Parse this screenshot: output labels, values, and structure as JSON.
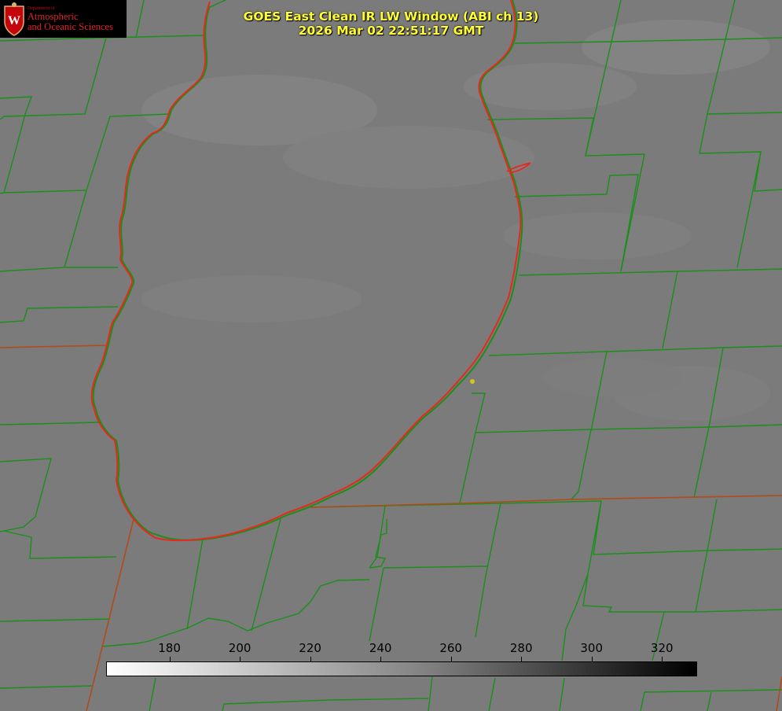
{
  "logo": {
    "department": "Department of",
    "line1": "Atmospheric",
    "line2": "and Oceanic Sciences"
  },
  "title": {
    "line1": "GOES East Clean IR LW Window (ABI ch 13)",
    "line2": "2026 Mar 02 22:51:17 GMT"
  },
  "colorbar": {
    "ticks": [
      "180",
      "200",
      "220",
      "240",
      "260",
      "280",
      "300",
      "320"
    ],
    "range": [
      162,
      330
    ],
    "colormap": "grayscale white-to-black"
  },
  "colors": {
    "background": "#7c7c7c",
    "county_lines": "#1a8f1a",
    "state_lines": "#b24a1a",
    "coastline": "#e8281e",
    "marker": "#d8c21a",
    "title": "#ffff33"
  }
}
